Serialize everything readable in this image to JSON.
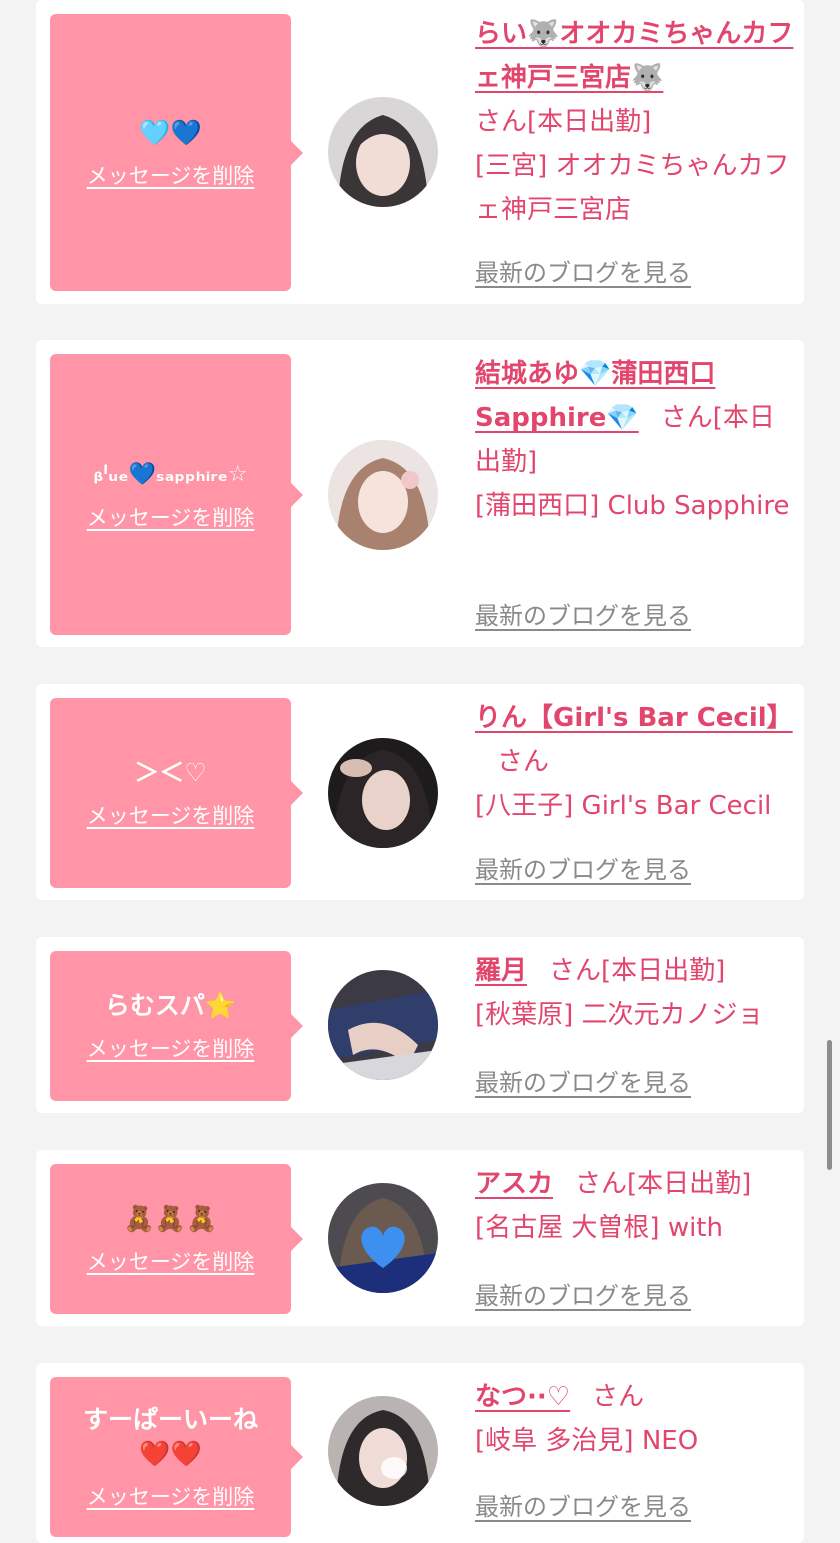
{
  "delete_label": "メッセージを削除",
  "blog_label": "最新のブログを見る",
  "colors": {
    "accent": "#e2466d",
    "bubble": "#ff95a6",
    "background": "#f3f3f3",
    "link_gray": "#8a8a8a"
  },
  "entries": [
    {
      "message": "🩵💙",
      "name": "らい🐺オオカミちゃんカフェ神戸三宮店🐺",
      "suffix": "さん[本日出勤]",
      "shop": "[三宮] オオカミちゃんカフェ神戸三宮店",
      "avatar_icon": "profile-photo"
    },
    {
      "message": "ᵦˡᵤₑ💙ₛₐₚₚₕᵢᵣₑ☆",
      "name": "結城あゆ💎蒲田西口Sapphire💎",
      "suffix": "さん[本日出勤]",
      "shop": "[蒲田西口] Club Sapphire",
      "avatar_icon": "profile-photo"
    },
    {
      "message": "＞＜♡",
      "name": "りん【Girl's Bar Cecil】",
      "suffix": "さん",
      "shop": "[八王子] Girl's Bar Cecil",
      "avatar_icon": "profile-photo"
    },
    {
      "message": "らむスパ⭐",
      "name": "羅月",
      "suffix": "さん[本日出勤]",
      "shop": "[秋葉原] 二次元カノジョ",
      "avatar_icon": "profile-photo"
    },
    {
      "message": "🧸🧸🧸",
      "name": "アスカ",
      "suffix": "さん[本日出勤]",
      "shop": "[名古屋 大曽根] with",
      "avatar_icon": "profile-photo-heart-covered"
    },
    {
      "message": "すーぱーいーね\n❤️❤️",
      "name": "なつ··♡",
      "suffix": "さん",
      "shop": "[岐阜 多治見] NEO",
      "avatar_icon": "profile-photo"
    }
  ]
}
